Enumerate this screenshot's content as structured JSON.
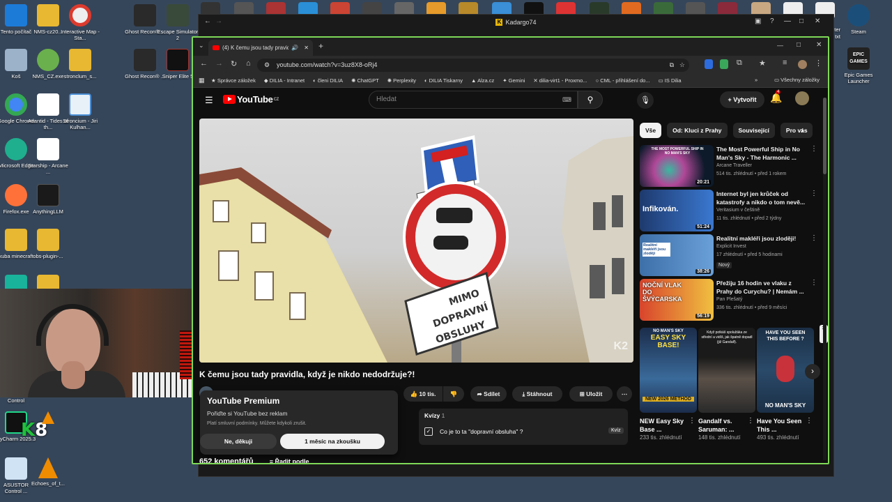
{
  "desktop": {
    "icons_left": [
      {
        "label": "Tento počítač"
      },
      {
        "label": "NMS-cz20..."
      },
      {
        "label": "Interactive Map - Sta..."
      },
      {
        "label": "Koš"
      },
      {
        "label": "NMS_CZ.exe"
      },
      {
        "label": "stronclum_s..."
      },
      {
        "label": "Google Chrome"
      },
      {
        "label": "Atlantid - Tides of th..."
      },
      {
        "label": "Stroncium - Jiri Kulhan..."
      },
      {
        "label": "Microsoft Edge"
      },
      {
        "label": "Starship - Arcane ..."
      },
      {
        "label": "Firefox.exe"
      },
      {
        "label": "AnythingLLM"
      },
      {
        "label": "kuba minecraft"
      },
      {
        "label": "obs-plugin-..."
      },
      {
        "label": "Control"
      },
      {
        "label": "PyCharm 2025.3"
      },
      {
        "label": "ASUSTOR Control ..."
      },
      {
        "label": "Echoes_of_t..."
      }
    ],
    "icons_top": [
      {
        "label": "Ghost Recon® ..."
      },
      {
        "label": "Escape Simulator 2"
      },
      {
        "label": "Ghost Recon® ..."
      },
      {
        "label": "Sniper Elite 5"
      }
    ],
    "icons_right": [
      {
        "label": "Steam"
      },
      {
        "label": "Epic Games Launcher"
      },
      {
        "label": "ter"
      },
      {
        "label": "txt"
      }
    ]
  },
  "outer_window": {
    "title": "Kadargo74"
  },
  "browser": {
    "tab_title": "(4) K čemu jsou tady pravid",
    "url": "youtube.com/watch?v=3uz8X8-oRj4",
    "bookmarks": [
      "Správce záložek",
      "DILIA - Intranet",
      "členi DILIA",
      "ChatGPT",
      "Perplexity",
      "DILIA Tiskarny",
      "Alza.cz",
      "Gemini",
      "dilia-virt1 - Proxmo...",
      "CML - přihlášení do...",
      "IS Dilia"
    ],
    "all_bookmarks": "Všechny záložky"
  },
  "youtube": {
    "logo": "YouTube",
    "logo_region": "CZ",
    "search_placeholder": "Hledat",
    "create_label": "Vytvořit",
    "notifications": "4",
    "video": {
      "title": "K čemu jsou tady pravidla, když je nikdo nedodržuje?!",
      "watermark": "K2",
      "likes": "10 tis.",
      "share": "Sdílet",
      "download": "Stáhnout",
      "save": "Uložit"
    },
    "premium_popup": {
      "title": "YouTube Premium",
      "subtitle": "Pořiďte si YouTube bez reklam",
      "terms": "Platí smluvní podmínky. Můžete kdykoli zrušit.",
      "decline": "Ne, děkuji",
      "trial": "1 měsíc na zkoušku"
    },
    "quiz": {
      "header": "Kvízy",
      "count": "1",
      "question": "Co je to ta \"dopravní obsluha\" ?",
      "badge": "Kvíz"
    },
    "comments": {
      "count": "652 komentářů",
      "sort": "Řadit podle"
    },
    "chips": [
      "Vše",
      "Od: Kluci z Prahy",
      "Související",
      "Pro vás"
    ],
    "recommendations": [
      {
        "title": "The Most Powerful Ship in No Man's Sky - The Harmonic ...",
        "channel": "Arcane Traveller",
        "meta": "514 tis. zhlédnutí • před 1 rokem",
        "duration": "20:21",
        "thumb_text": "THE MOST POWERFUL SHIP IN NO MAN'S SKY",
        "thumb_color": "#0d1a2a"
      },
      {
        "title": "Internet byl jen krůček od katastrofy a nikdo o tom nevě...",
        "channel": "Veritasium v češtině",
        "meta": "11 tis. zhlédnutí • před 2 týdny",
        "duration": "51:24",
        "thumb_text": "Infikován.",
        "thumb_color": "#1e3a6e"
      },
      {
        "title": "Realitní makléři jsou zloději!",
        "channel": "Explicit Invest",
        "meta": "17 zhlédnutí • před 5 hodinami",
        "badge": "Nový",
        "duration": "38:26",
        "thumb_text": "Realitní makléři jsou zloději",
        "thumb_color": "#3d6fa8"
      },
      {
        "title": "Přežiju 16 hodin ve vlaku z Prahy do Curychu? | Nemám ...",
        "channel": "Pan Plešatý",
        "meta": "336 tis. zhlédnutí • před 9 měsíci",
        "duration": "56:19",
        "thumb_text": "NOČNÍ VLAK DO ŠVÝCARSKA",
        "thumb_color": "#d8442c"
      }
    ],
    "shorts": [
      {
        "title": "NEW Easy Sky Base ...",
        "views": "233 tis. zhlédnutí",
        "thumb_top": "NO MAN'S SKY",
        "thumb_mid": "EASY SKY BASE!",
        "thumb_bottom": "NEW 2026 METHOD",
        "thumb_color": "#1b2c4a"
      },
      {
        "title": "Gandalf vs. Saruman: ...",
        "views": "148 tis. zhlédnutí",
        "thumb_top": "Když potkáš spolužáka ze střední a vidíš, jak špatně dopadl (již Gandalf).",
        "thumb_color": "#1a1a1a"
      },
      {
        "title": "Have You Seen This ...",
        "views": "493 tis. zhlédnutí",
        "thumb_top": "HAVE YOU SEEN THIS BEFORE ?",
        "thumb_bottom": "NO MAN'S SKY",
        "thumb_color": "#1b2f45"
      }
    ]
  },
  "colors": {
    "accent_green": "#7ed957",
    "yt_red": "#ff0000",
    "bg_dark": "#0f0f0f"
  }
}
